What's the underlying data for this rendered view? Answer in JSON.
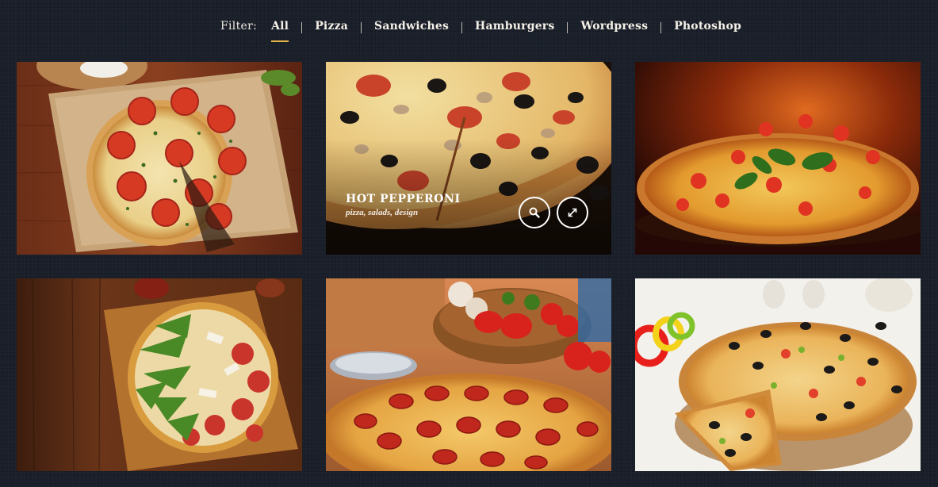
{
  "filter": {
    "label": "Filter:",
    "items": [
      "All",
      "Pizza",
      "Sandwiches",
      "Hamburgers",
      "Wordpress",
      "Photoshop"
    ],
    "active": "All"
  },
  "portfolio": {
    "items": [
      {
        "image": "pizza-margherita-wood-board"
      },
      {
        "image": "pizza-olives-closeup",
        "title": "HOT PEPPERONI",
        "tags": "pizza, salads, design"
      },
      {
        "image": "pizza-basil-dark"
      },
      {
        "image": "pizza-arugula-wood"
      },
      {
        "image": "pizza-pepperoni-vegetables"
      },
      {
        "image": "pizza-olives-white"
      }
    ]
  },
  "icons": {
    "zoom": "search-icon",
    "expand": "expand-icon"
  },
  "colors": {
    "accent": "#e2b64a",
    "background": "#1a1f2a"
  }
}
